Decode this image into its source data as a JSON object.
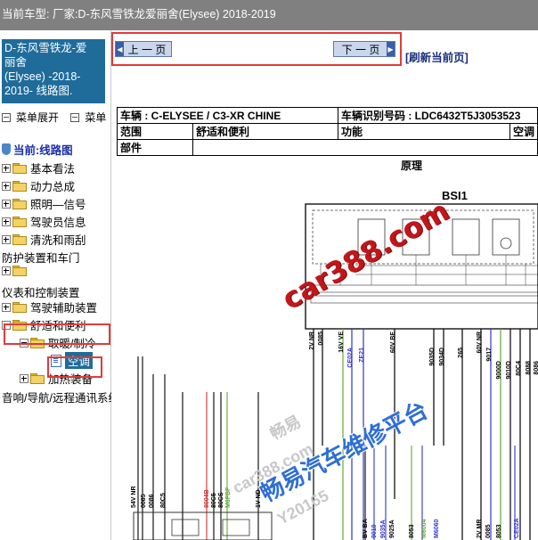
{
  "topbar": {
    "text": "当前车型:  厂家:D-东风雪铁龙爱丽舍(Elysee)    2018-2019"
  },
  "sidebar": {
    "title_lines": [
      "D-东风雪铁龙-爱",
      "丽舍",
      "(Elysee)    -2018-",
      "2019- 线路图."
    ],
    "menu": [
      "菜单展开",
      "菜单"
    ],
    "tree": {
      "current": "当前:线路图",
      "items": [
        "基本看法",
        "动力总成",
        "照明—信号",
        "驾驶员信息",
        "清洗和雨刮",
        "防护装置和车门",
        "仪表和控制装置",
        "驾驶辅助装置",
        "舒适和便利",
        "取暖/制冷",
        "空调",
        "加热装备",
        "音响/导航/远程通讯系统"
      ]
    }
  },
  "nav": {
    "prev": "上 一 页",
    "next": "下 一 页",
    "refresh": "[刷新当前页]"
  },
  "doc": {
    "vehicle": "车辆 : C-ELYSEE / C3-XR CHINE",
    "vin": "车辆识别号码 :  LDC6432T5J3053523",
    "scope_label": "范围",
    "scope_value": "舒适和便利",
    "function_label": "功能",
    "function_value": "空调",
    "part_label": "部件",
    "section_title": "原理",
    "module_title": "BSI1"
  },
  "diagram_labels": {
    "top": [
      "2V NR",
      "0085",
      "16V VE",
      "CE02A",
      "ZE21",
      "60V BE",
      "9035D",
      "9034D",
      "265",
      "60V NR",
      "9017",
      "9000D",
      "9010D",
      "80C4",
      "8088",
      "8086"
    ],
    "lower": [
      "54V NR",
      "0085",
      "0086",
      "80C5",
      "8004B",
      "80C5",
      "80CS",
      "M6FBF",
      "1V ND",
      "BV BA",
      "9010",
      "9035A",
      "9025A",
      "8053",
      "M6004",
      "M6060",
      "2V MR",
      "0085",
      "8053",
      "CE02A"
    ]
  },
  "watermarks": [
    "car388.com",
    "畅易汽车维修平台",
    "畅易",
    "car388.com",
    "Y20165"
  ],
  "colors": {
    "sidebar_blue": "#1f6c9a",
    "nav_blue": "#c9d6ec",
    "annotation_red": "#e23a3a",
    "watermark_red": "#c2161a",
    "watermark_blue": "#2e6fd3"
  }
}
